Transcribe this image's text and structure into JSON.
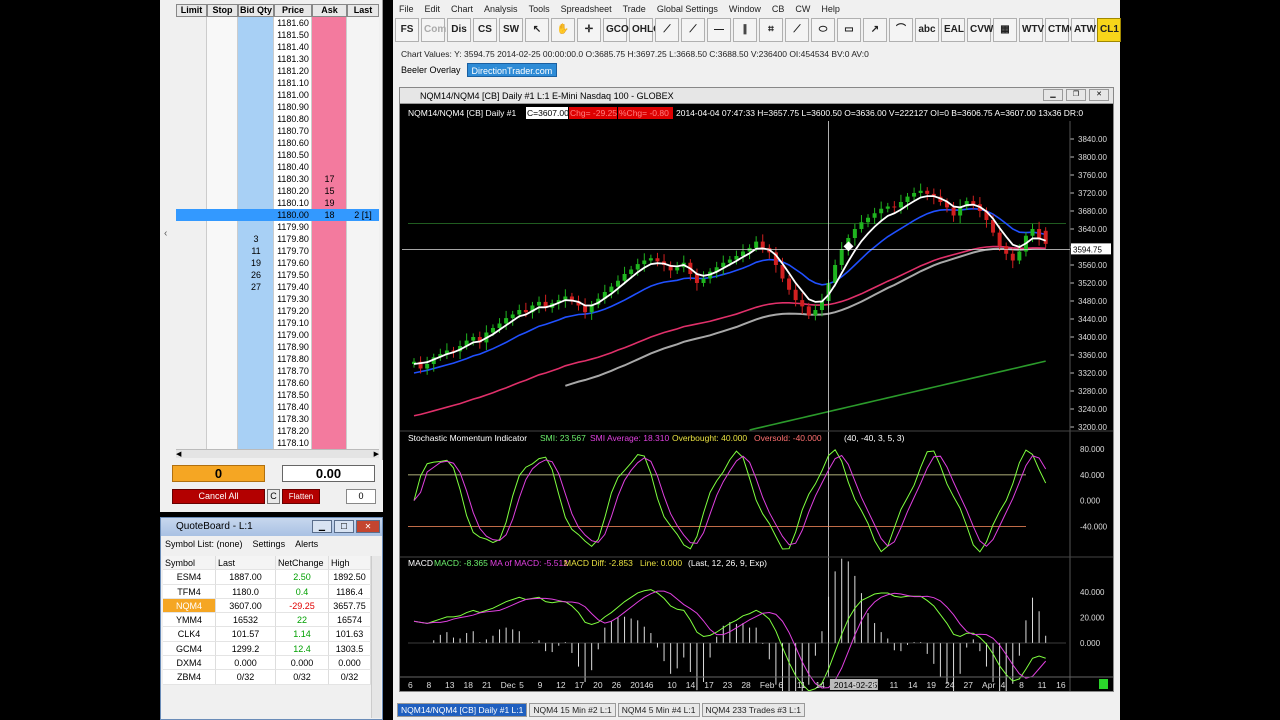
{
  "dom": {
    "headers": [
      "Limit",
      "Stop",
      "Bid Qty",
      "Price",
      "Ask Qty",
      "Last"
    ],
    "rows": [
      {
        "price": "1181.60",
        "bid": "",
        "ask": "",
        "last": ""
      },
      {
        "price": "1181.50",
        "bid": "",
        "ask": "",
        "last": ""
      },
      {
        "price": "1181.40",
        "bid": "",
        "ask": "",
        "last": ""
      },
      {
        "price": "1181.30",
        "bid": "",
        "ask": "",
        "last": ""
      },
      {
        "price": "1181.20",
        "bid": "",
        "ask": "",
        "last": ""
      },
      {
        "price": "1181.10",
        "bid": "",
        "ask": "",
        "last": ""
      },
      {
        "price": "1181.00",
        "bid": "",
        "ask": "",
        "last": ""
      },
      {
        "price": "1180.90",
        "bid": "",
        "ask": "",
        "last": ""
      },
      {
        "price": "1180.80",
        "bid": "",
        "ask": "",
        "last": ""
      },
      {
        "price": "1180.70",
        "bid": "",
        "ask": "",
        "last": ""
      },
      {
        "price": "1180.60",
        "bid": "",
        "ask": "",
        "last": ""
      },
      {
        "price": "1180.50",
        "bid": "",
        "ask": "",
        "last": ""
      },
      {
        "price": "1180.40",
        "bid": "",
        "ask": "",
        "last": ""
      },
      {
        "price": "1180.30",
        "bid": "",
        "ask": "17",
        "last": ""
      },
      {
        "price": "1180.20",
        "bid": "",
        "ask": "15",
        "last": ""
      },
      {
        "price": "1180.10",
        "bid": "",
        "ask": "19",
        "last": ""
      },
      {
        "price": "1180.00",
        "bid": "",
        "ask": "18",
        "last": "2 [1]",
        "selected": true
      },
      {
        "price": "1179.90",
        "bid": "",
        "ask": "",
        "last": ""
      },
      {
        "price": "1179.80",
        "bid": "3",
        "ask": "",
        "last": ""
      },
      {
        "price": "1179.70",
        "bid": "11",
        "ask": "",
        "last": ""
      },
      {
        "price": "1179.60",
        "bid": "19",
        "ask": "",
        "last": ""
      },
      {
        "price": "1179.50",
        "bid": "26",
        "ask": "",
        "last": ""
      },
      {
        "price": "1179.40",
        "bid": "27",
        "ask": "",
        "last": ""
      },
      {
        "price": "1179.30",
        "bid": "",
        "ask": "",
        "last": ""
      },
      {
        "price": "1179.20",
        "bid": "",
        "ask": "",
        "last": ""
      },
      {
        "price": "1179.10",
        "bid": "",
        "ask": "",
        "last": ""
      },
      {
        "price": "1179.00",
        "bid": "",
        "ask": "",
        "last": ""
      },
      {
        "price": "1178.90",
        "bid": "",
        "ask": "",
        "last": ""
      },
      {
        "price": "1178.80",
        "bid": "",
        "ask": "",
        "last": ""
      },
      {
        "price": "1178.70",
        "bid": "",
        "ask": "",
        "last": ""
      },
      {
        "price": "1178.60",
        "bid": "",
        "ask": "",
        "last": ""
      },
      {
        "price": "1178.50",
        "bid": "",
        "ask": "",
        "last": ""
      },
      {
        "price": "1178.40",
        "bid": "",
        "ask": "",
        "last": ""
      },
      {
        "price": "1178.30",
        "bid": "",
        "ask": "",
        "last": ""
      },
      {
        "price": "1178.20",
        "bid": "",
        "ask": "",
        "last": ""
      },
      {
        "price": "1178.10",
        "bid": "",
        "ask": "",
        "last": ""
      }
    ]
  },
  "position": {
    "qty": "0",
    "pl": "0.00",
    "cancel_all": "Cancel All",
    "c_label": "C",
    "flatten": "Flatten",
    "spin_value": "0"
  },
  "quoteboard": {
    "title": "QuoteBoard - L:1",
    "menu": [
      "Symbol List: (none)",
      "Settings",
      "Alerts"
    ],
    "headers": [
      "Symbol",
      "Last",
      "NetChange",
      "High"
    ],
    "rows": [
      {
        "symbol": "ESM4",
        "last": "1887.00",
        "change": "2.50",
        "high": "1892.50",
        "dir": "pos"
      },
      {
        "symbol": "TFM4",
        "last": "1180.0",
        "change": "0.4",
        "high": "1186.4",
        "dir": "pos"
      },
      {
        "symbol": "NQM4",
        "last": "3607.00",
        "change": "-29.25",
        "high": "3657.75",
        "dir": "neg",
        "selected": true
      },
      {
        "symbol": "YMM4",
        "last": "16532",
        "change": "22",
        "high": "16574",
        "dir": "pos"
      },
      {
        "symbol": "CLK4",
        "last": "101.57",
        "change": "1.14",
        "high": "101.63",
        "dir": "pos"
      },
      {
        "symbol": "GCM4",
        "last": "1299.2",
        "change": "12.4",
        "high": "1303.5",
        "dir": "pos"
      },
      {
        "symbol": "DXM4",
        "last": "0.000",
        "change": "0.000",
        "high": "0.000",
        "dir": "none"
      },
      {
        "symbol": "ZBM4",
        "last": "0/32",
        "change": "0/32",
        "high": "0/32",
        "dir": "none"
      }
    ]
  },
  "app": {
    "menu": [
      "File",
      "Edit",
      "Chart",
      "Analysis",
      "Tools",
      "Spreadsheet",
      "Trade",
      "Global Settings",
      "Window",
      "CB",
      "CW",
      "Help"
    ],
    "toolbar": [
      "FS",
      "Com",
      "Dis",
      "CS",
      "SW",
      "↖",
      "✋",
      "✛",
      "GCO",
      "OHLC",
      "⟋",
      "⟋",
      "—",
      "∥",
      "⌗",
      "⟋",
      "⬭",
      "▭",
      "↗",
      "⌒",
      "abc",
      "EAL",
      "CVW",
      "▦",
      "WTV",
      "CTMO",
      "ATW",
      "CL1"
    ],
    "chart_values": "Chart Values: Y: 3594.75  2014-02-25  00:00:00.0  O:3685.75  H:3697.25  L:3668.50  C:3688.50  V:236400  OI:454534  BV:0  AV:0",
    "study_label": "Beeler Overlay",
    "dt_button": "DirectionTrader.com",
    "window_title": "NQM14/NQM4 [CB]  Daily  #1  L:1  E-Mini Nasdaq 100 - GLOBEX"
  },
  "chart_header": {
    "symbol": "NQM14/NQM4 [CB]  Daily  #1",
    "close": "C=3607.00",
    "chg": "Chg= -29.25",
    "pchg": "%Chg= -0.80",
    "rest": "2014-04-04 07:47:33 H=3657.75 L=3600.50 O=3636.00 V=222127 OI=0 B=3606.75 A=3607.00 13x36 DR:0"
  },
  "crosshair_label": "3594.75",
  "smi_header": {
    "name": "Stochastic Momentum Indicator",
    "smi": "SMI: 23.567",
    "avg": "SMI Average: 18.310",
    "ob": "Overbought: 40.000",
    "os": "Oversold: -40.000",
    "params": "(40, -40, 3, 5, 3)"
  },
  "macd_header": {
    "name": "MACD",
    "macd": "MACD: -8.365",
    "ma": "MA of MACD: -5.512",
    "diff": "MACD Diff: -2.853",
    "line": "Line: 0.000",
    "params": "(Last, 12, 26, 9, Exp)"
  },
  "date_cursor": "2014-02-25",
  "tabs": [
    "NQM14/NQM4 [CB]  Daily  #1  L:1",
    "NQM4  15 Min  #2  L:1",
    "NQM4  5 Min  #4  L:1",
    "NQM4  233 Trades  #3  L:1"
  ],
  "colors": {
    "accent": "#f5a623",
    "bid": "#a8d0f5",
    "ask": "#f37a9e",
    "up_candle": "#1fb51f",
    "down_candle": "#d12020"
  },
  "chart_data": [
    {
      "type": "candlestick",
      "title": "NQM14/NQM4 [CB] Daily",
      "ylim": [
        3200,
        3880
      ],
      "y_ticks": [
        "3840.00",
        "3800.00",
        "3760.00",
        "3720.00",
        "3680.00",
        "3640.00",
        "3600.00",
        "3560.00",
        "3520.00",
        "3480.00",
        "3440.00",
        "3400.00",
        "3360.00",
        "3320.00",
        "3280.00",
        "3240.00",
        "3200.00"
      ],
      "x_ticks": [
        "6",
        "8",
        "13",
        "18",
        "21",
        "Dec",
        "5",
        "9",
        "12",
        "17",
        "20",
        "26",
        "2014",
        "6",
        "10",
        "14",
        "17",
        "23",
        "28",
        "Feb",
        "6",
        "11",
        "14",
        "2014-02-25",
        "3",
        "6",
        "11",
        "14",
        "19",
        "24",
        "27",
        "Apr",
        "4",
        "8",
        "11",
        "16"
      ],
      "close": [
        3345,
        3330,
        3340,
        3355,
        3362,
        3370,
        3368,
        3380,
        3392,
        3400,
        3388,
        3410,
        3420,
        3430,
        3442,
        3450,
        3460,
        3455,
        3470,
        3478,
        3465,
        3475,
        3482,
        3490,
        3480,
        3470,
        3455,
        3472,
        3485,
        3500,
        3512,
        3525,
        3540,
        3550,
        3562,
        3570,
        3575,
        3568,
        3560,
        3548,
        3555,
        3565,
        3540,
        3520,
        3530,
        3545,
        3555,
        3565,
        3572,
        3580,
        3590,
        3598,
        3612,
        3598,
        3588,
        3560,
        3530,
        3505,
        3482,
        3468,
        3448,
        3460,
        3480,
        3520,
        3560,
        3595,
        3620,
        3640,
        3655,
        3665,
        3675,
        3685,
        3690,
        3688,
        3700,
        3712,
        3720,
        3725,
        3718,
        3712,
        3700,
        3688,
        3670,
        3690,
        3702,
        3695,
        3680,
        3660,
        3632,
        3602,
        3585,
        3570,
        3590,
        3625,
        3640,
        3620,
        3607
      ],
      "open": [
        3340,
        3345,
        3330,
        3340,
        3355,
        3362,
        3370,
        3368,
        3380,
        3392,
        3400,
        3388,
        3410,
        3420,
        3430,
        3442,
        3450,
        3460,
        3455,
        3470,
        3478,
        3465,
        3475,
        3482,
        3490,
        3480,
        3470,
        3455,
        3472,
        3485,
        3500,
        3512,
        3525,
        3540,
        3550,
        3562,
        3570,
        3575,
        3568,
        3560,
        3548,
        3555,
        3565,
        3540,
        3520,
        3530,
        3545,
        3555,
        3565,
        3572,
        3580,
        3590,
        3598,
        3612,
        3598,
        3588,
        3560,
        3530,
        3505,
        3482,
        3468,
        3448,
        3460,
        3480,
        3520,
        3560,
        3595,
        3620,
        3640,
        3655,
        3665,
        3675,
        3685,
        3690,
        3688,
        3700,
        3712,
        3720,
        3725,
        3718,
        3712,
        3700,
        3688,
        3670,
        3690,
        3702,
        3695,
        3680,
        3660,
        3632,
        3602,
        3585,
        3570,
        3590,
        3625,
        3640,
        3636
      ],
      "ema_fast": [
        3340,
        3342,
        3344,
        3350,
        3356,
        3362,
        3366,
        3372,
        3380,
        3388,
        3390,
        3398,
        3406,
        3416,
        3426,
        3436,
        3446,
        3450,
        3458,
        3466,
        3466,
        3470,
        3476,
        3482,
        3481,
        3478,
        3470,
        3470,
        3476,
        3486,
        3496,
        3508,
        3520,
        3532,
        3544,
        3554,
        3562,
        3564,
        3563,
        3558,
        3557,
        3560,
        3552,
        3540,
        3536,
        3539,
        3545,
        3553,
        3561,
        3569,
        3578,
        3586,
        3596,
        3597,
        3594,
        3582,
        3563,
        3542,
        3520,
        3502,
        3484,
        3478,
        3479,
        3494,
        3516,
        3542,
        3568,
        3592,
        3613,
        3630,
        3645,
        3658,
        3669,
        3675,
        3683,
        3693,
        3702,
        3710,
        3713,
        3713,
        3708,
        3701,
        3690,
        3688,
        3693,
        3694,
        3689,
        3679,
        3663,
        3642,
        3623,
        3605,
        3600,
        3608,
        3619,
        3619,
        3614
      ],
      "ema_mid": [
        3320,
        3323,
        3326,
        3330,
        3334,
        3338,
        3342,
        3347,
        3352,
        3358,
        3362,
        3368,
        3374,
        3381,
        3388,
        3396,
        3404,
        3410,
        3417,
        3424,
        3428,
        3433,
        3438,
        3444,
        3447,
        3450,
        3451,
        3453,
        3457,
        3462,
        3468,
        3475,
        3482,
        3490,
        3498,
        3506,
        3513,
        3518,
        3522,
        3524,
        3526,
        3530,
        3531,
        3530,
        3530,
        3532,
        3535,
        3539,
        3543,
        3548,
        3553,
        3559,
        3566,
        3570,
        3572,
        3571,
        3567,
        3560,
        3550,
        3540,
        3528,
        3520,
        3516,
        3518,
        3524,
        3534,
        3546,
        3560,
        3574,
        3588,
        3600,
        3612,
        3623,
        3632,
        3641,
        3650,
        3659,
        3667,
        3674,
        3679,
        3682,
        3683,
        3682,
        3682,
        3684,
        3685,
        3684,
        3680,
        3673,
        3663,
        3652,
        3640,
        3633,
        3632,
        3633,
        3631,
        3628
      ],
      "ema_slow": [
        3225,
        3228,
        3232,
        3236,
        3240,
        3244,
        3248,
        3252,
        3257,
        3262,
        3266,
        3271,
        3276,
        3282,
        3287,
        3293,
        3299,
        3304,
        3310,
        3316,
        3320,
        3325,
        3330,
        3336,
        3340,
        3344,
        3347,
        3351,
        3355,
        3360,
        3365,
        3371,
        3376,
        3382,
        3388,
        3394,
        3400,
        3405,
        3410,
        3414,
        3418,
        3423,
        3426,
        3429,
        3432,
        3435,
        3439,
        3443,
        3447,
        3451,
        3456,
        3461,
        3466,
        3470,
        3473,
        3475,
        3476,
        3476,
        3475,
        3474,
        3472,
        3471,
        3471,
        3472,
        3475,
        3479,
        3484,
        3490,
        3496,
        3503,
        3510,
        3517,
        3524,
        3530,
        3537,
        3544,
        3551,
        3558,
        3564,
        3570,
        3575,
        3579,
        3583,
        3587,
        3591,
        3595,
        3598,
        3600,
        3601,
        3601,
        3600,
        3598,
        3597,
        3597,
        3598,
        3598,
        3597
      ]
    }
  ]
}
